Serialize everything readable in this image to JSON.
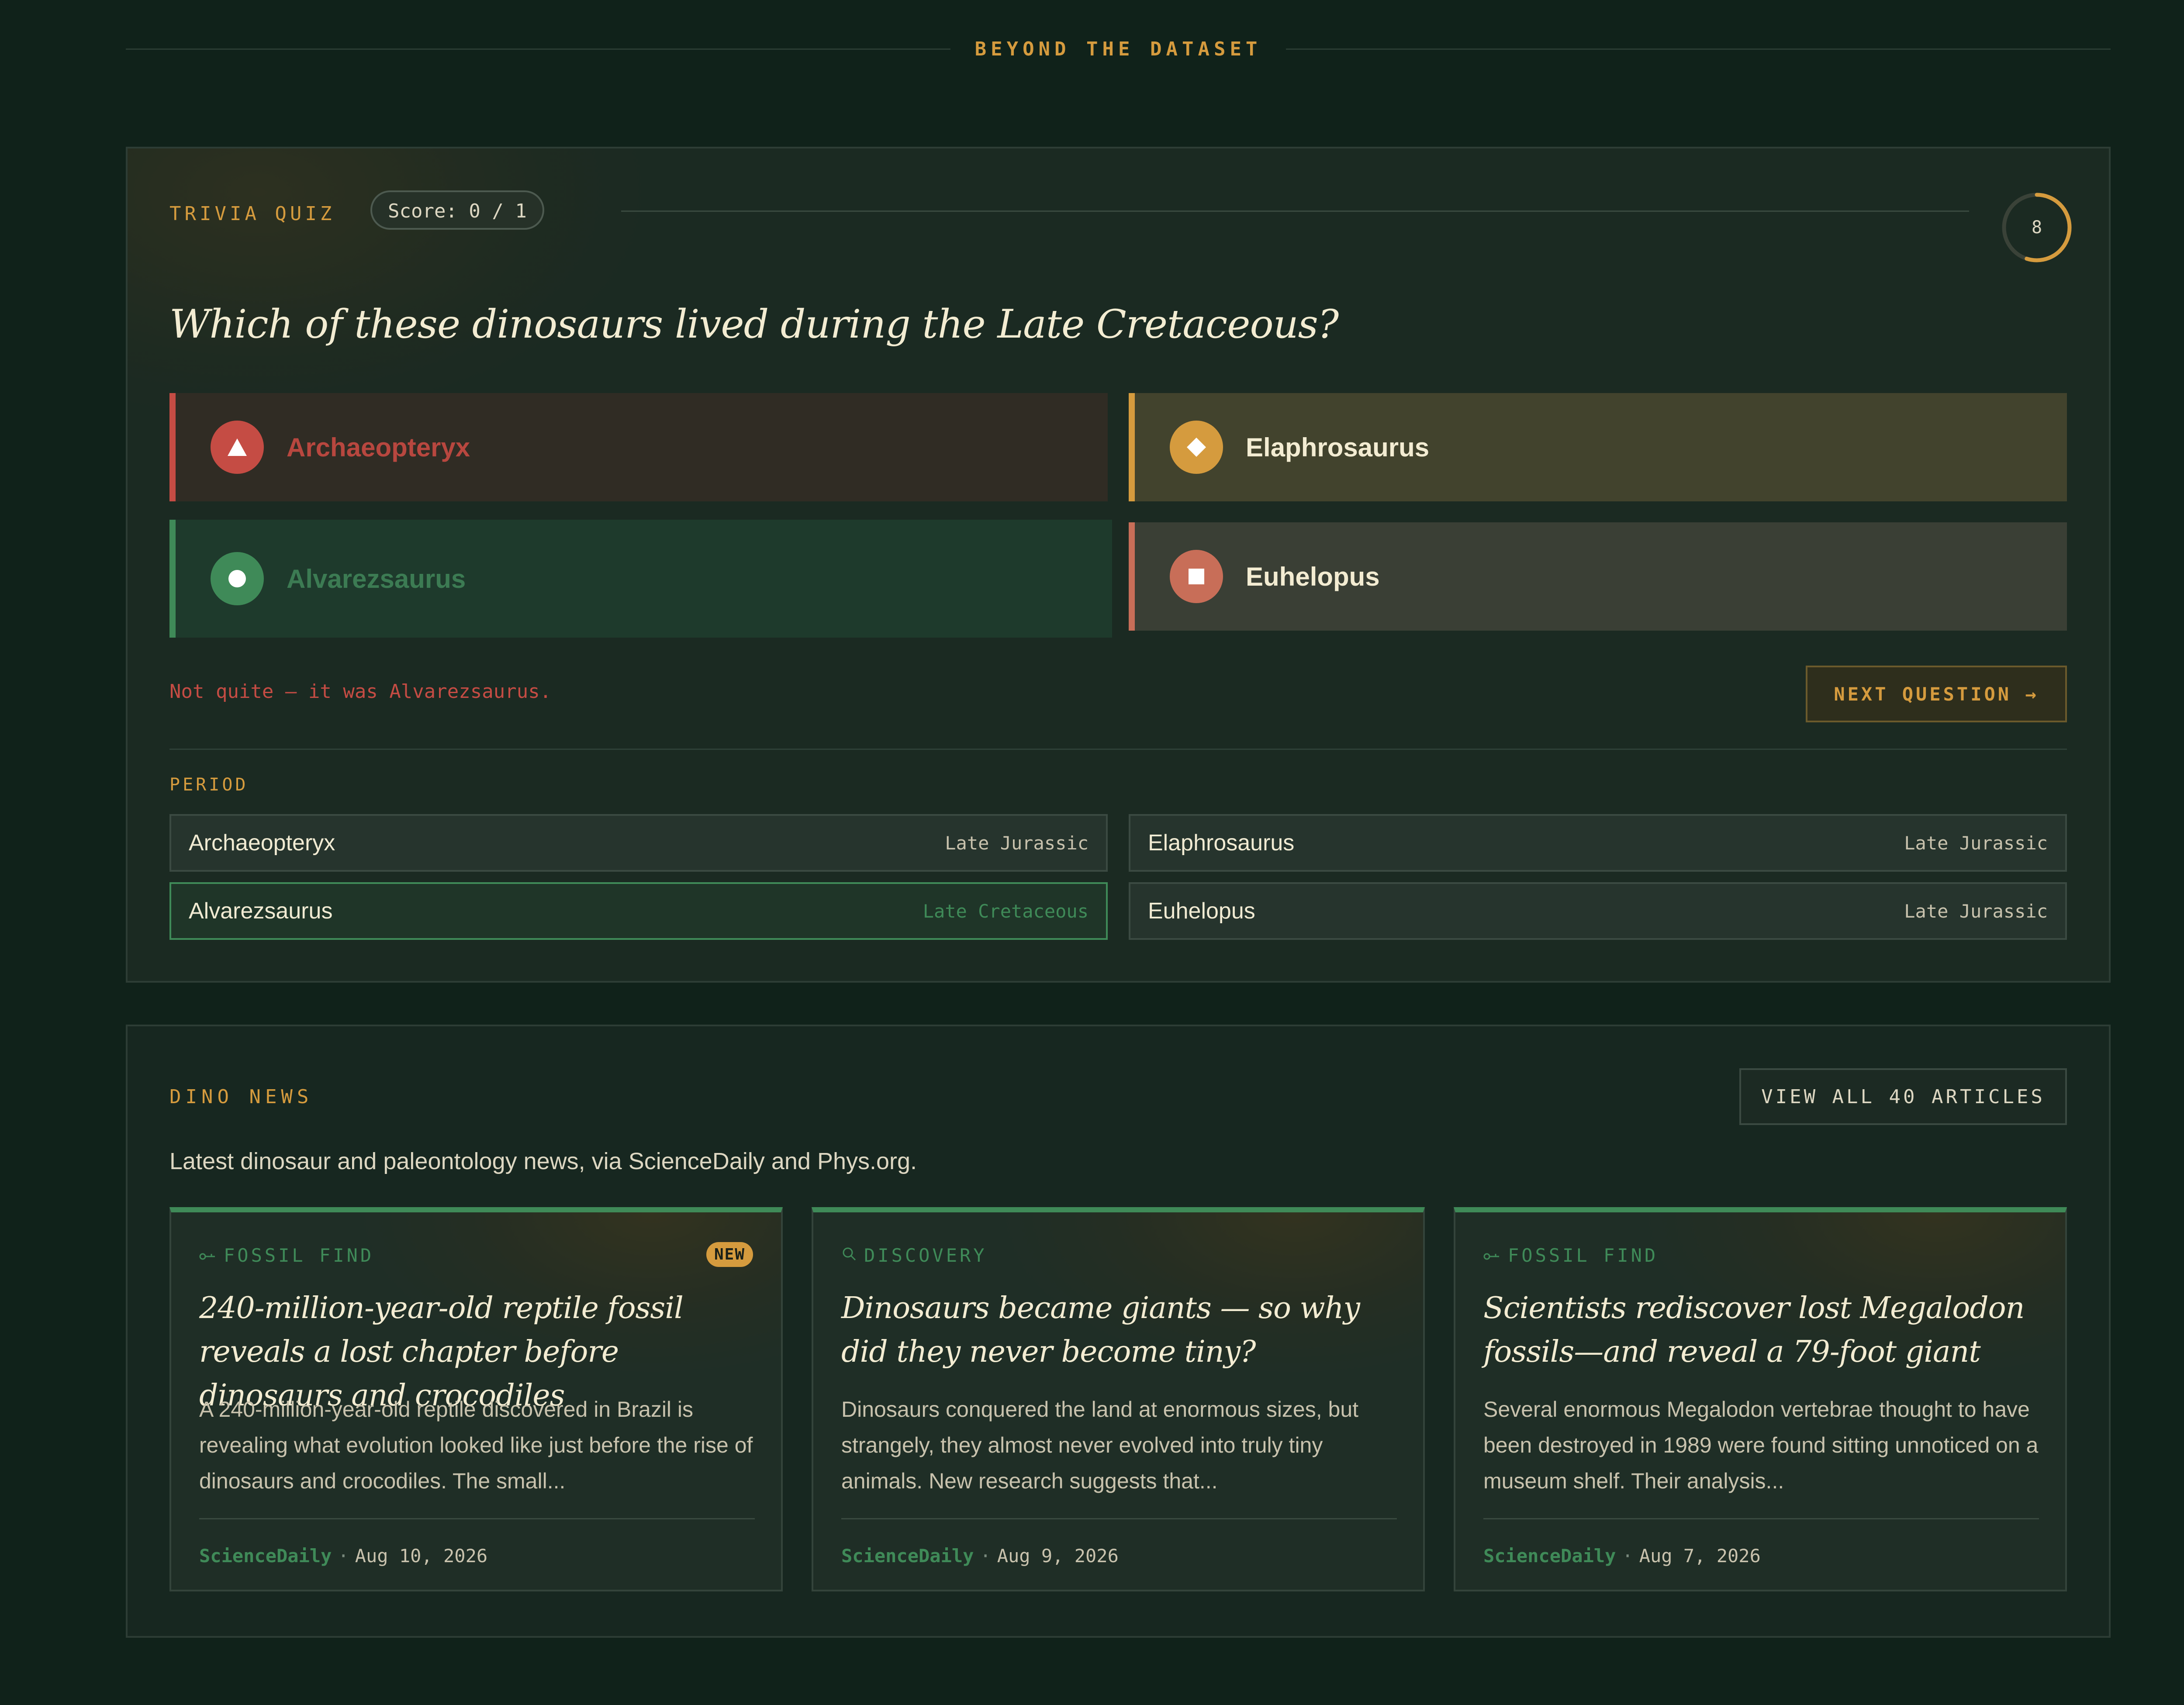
{
  "section": {
    "title": "BEYOND THE DATASET"
  },
  "quiz": {
    "label": "TRIVIA QUIZ",
    "score": "Score: 0 / 1",
    "timer": "8",
    "timer_fraction": 0.55,
    "question": "Which of these dinosaurs lived during the Late Cretaceous?",
    "options": [
      {
        "label": "Archaeopteryx",
        "shape": "triangle-icon",
        "state": "wrong-selected",
        "color": "#c54c44"
      },
      {
        "label": "Elaphrosaurus",
        "shape": "diamond-icon",
        "state": "neutral",
        "color": "#d59b3e"
      },
      {
        "label": "Alvarezsaurus",
        "shape": "circle-icon",
        "state": "correct",
        "color": "#3f8a58"
      },
      {
        "label": "Euhelopus",
        "shape": "square-icon",
        "state": "neutral",
        "color": "#c86e58"
      }
    ],
    "feedback": "Not quite — it was Alvarezsaurus.",
    "next_button": "NEXT QUESTION →",
    "period_label": "PERIOD",
    "periods": [
      {
        "name": "Archaeopteryx",
        "period": "Late Jurassic"
      },
      {
        "name": "Elaphrosaurus",
        "period": "Late Jurassic"
      },
      {
        "name": "Alvarezsaurus",
        "period": "Late Cretaceous"
      },
      {
        "name": "Euhelopus",
        "period": "Late Jurassic"
      }
    ]
  },
  "news": {
    "label": "DINO NEWS",
    "view_all": "VIEW ALL 40 ARTICLES",
    "subtitle": "Latest dinosaur and paleontology news, via ScienceDaily and Phys.org.",
    "articles": [
      {
        "category": "FOSSIL FIND",
        "category_icon": "bone-icon",
        "badge": "NEW",
        "title": "240-million-year-old reptile fossil reveals a lost chapter before dinosaurs and crocodiles",
        "summary": "A 240-million-year-old reptile discovered in Brazil is revealing what evolution looked like just before the rise of dinosaurs and crocodiles. The small...",
        "source": "ScienceDaily",
        "date": "Aug 10, 2026"
      },
      {
        "category": "DISCOVERY",
        "category_icon": "magnifier-icon",
        "title": "Dinosaurs became giants — so why did they never become tiny?",
        "summary": "Dinosaurs conquered the land at enormous sizes, but strangely, they almost never evolved into truly tiny animals. New research suggests that...",
        "source": "ScienceDaily",
        "date": "Aug 9, 2026"
      },
      {
        "category": "FOSSIL FIND",
        "category_icon": "bone-icon",
        "title": "Scientists rediscover lost Megalodon fossils—and reveal a 79-foot giant",
        "summary": "Several enormous Megalodon vertebrae thought to have been destroyed in 1989 were found sitting unnoticed on a museum shelf. Their analysis...",
        "source": "ScienceDaily",
        "date": "Aug 7, 2026"
      }
    ]
  }
}
